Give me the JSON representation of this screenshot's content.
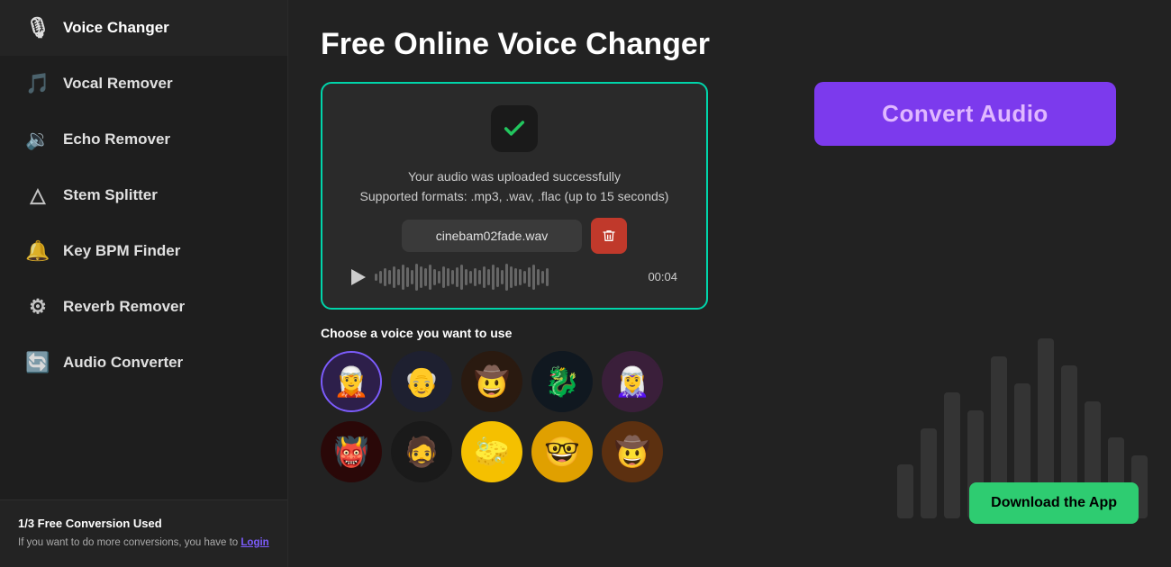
{
  "sidebar": {
    "items": [
      {
        "id": "voice-changer",
        "label": "Voice Changer",
        "icon": "🎙",
        "active": true
      },
      {
        "id": "vocal-remover",
        "label": "Vocal Remover",
        "icon": "🎵",
        "active": false
      },
      {
        "id": "echo-remover",
        "label": "Echo Remover",
        "icon": "🔉",
        "active": false
      },
      {
        "id": "stem-splitter",
        "label": "Stem Splitter",
        "icon": "△",
        "active": false
      },
      {
        "id": "key-bpm-finder",
        "label": "Key BPM Finder",
        "icon": "🔔",
        "active": false
      },
      {
        "id": "reverb-remover",
        "label": "Reverb Remover",
        "icon": "⚙",
        "active": false
      },
      {
        "id": "audio-converter",
        "label": "Audio Converter",
        "icon": "🔄",
        "active": false
      }
    ],
    "bottom": {
      "title": "1/3 Free Conversion Used",
      "desc": "If you want to do more conversions, you have to ",
      "login_label": "Login"
    }
  },
  "main": {
    "page_title": "Free Online Voice Changer",
    "upload": {
      "success_text": "Your audio was uploaded successfully",
      "formats_text": "Supported formats: .mp3, .wav, .flac (up to 15 seconds)",
      "file_name": "cinebam02fade.wav",
      "duration": "00:04"
    },
    "voice_section": {
      "label": "Choose a voice you want to use",
      "voices": [
        {
          "id": 1,
          "color": "#3a2a5c",
          "emoji": "🧝",
          "selected": true
        },
        {
          "id": 2,
          "color": "#2a2a3a",
          "emoji": "👴",
          "selected": false
        },
        {
          "id": 3,
          "color": "#3a2a2a",
          "emoji": "🤠",
          "selected": false
        },
        {
          "id": 4,
          "color": "#1a2a1a",
          "emoji": "🐉",
          "selected": false
        },
        {
          "id": 5,
          "color": "#4a2a4a",
          "emoji": "🧝‍♀️",
          "selected": false
        },
        {
          "id": 6,
          "color": "#3a1a1a",
          "emoji": "👹",
          "selected": false
        },
        {
          "id": 7,
          "color": "#2a2a2a",
          "emoji": "🧔",
          "selected": false
        },
        {
          "id": 8,
          "color": "#f5c518",
          "emoji": "🧽",
          "selected": false
        },
        {
          "id": 9,
          "color": "#e8a020",
          "emoji": "🤓",
          "selected": false
        },
        {
          "id": 10,
          "color": "#8B4513",
          "emoji": "🤠",
          "selected": false
        }
      ]
    },
    "convert_button_label": "Convert Audio",
    "download_app_label": "Download the App"
  }
}
